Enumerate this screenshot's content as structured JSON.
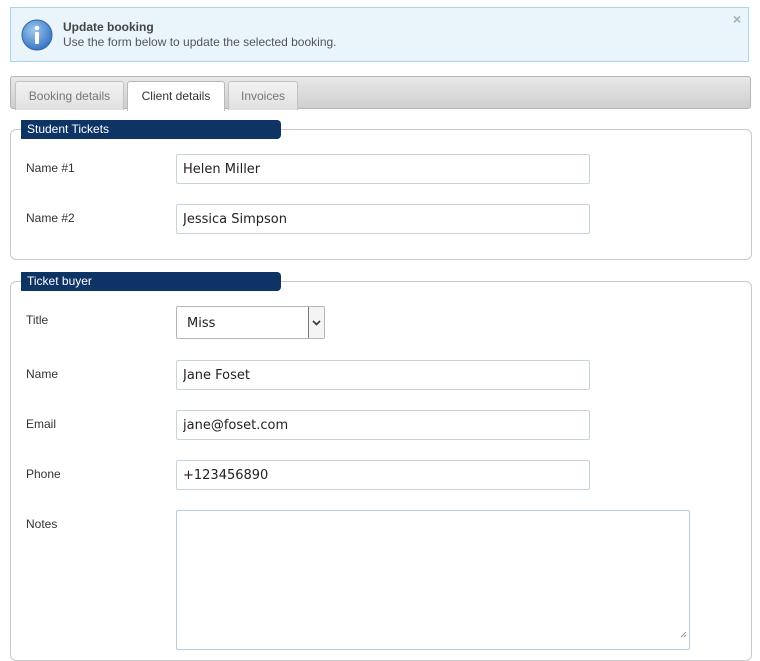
{
  "notice": {
    "title": "Update booking",
    "message": "Use the form below to update the selected booking.",
    "close": "×"
  },
  "tabs": [
    {
      "label": "Booking details",
      "active": false
    },
    {
      "label": "Client details",
      "active": true
    },
    {
      "label": "Invoices",
      "active": false
    }
  ],
  "student_tickets": {
    "legend": "Student Tickets",
    "fields": [
      {
        "label": "Name #1",
        "value": "Helen Miller"
      },
      {
        "label": "Name #2",
        "value": "Jessica Simpson"
      }
    ]
  },
  "ticket_buyer": {
    "legend": "Ticket buyer",
    "title": {
      "label": "Title",
      "value": "Miss"
    },
    "name": {
      "label": "Name",
      "value": "Jane Foset"
    },
    "email": {
      "label": "Email",
      "value": "jane@foset.com"
    },
    "phone": {
      "label": "Phone",
      "value": "+123456890"
    },
    "notes": {
      "label": "Notes",
      "value": ""
    }
  },
  "colors": {
    "legend_bg": "#0e3466",
    "notice_bg": "#e9f4fb",
    "notice_border": "#a9d3ef"
  },
  "icons": {
    "notice": "info-icon",
    "close": "close-icon",
    "select_arrow": "chevron-down-icon",
    "resize": "resize-handle-icon"
  }
}
